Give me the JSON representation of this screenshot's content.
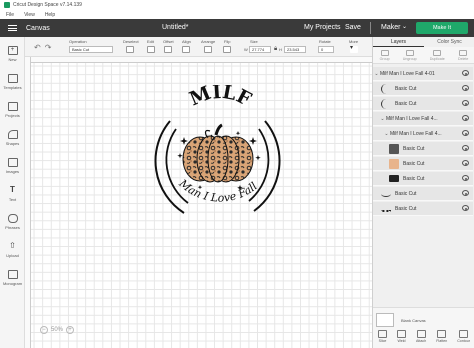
{
  "window": {
    "title": "Cricut Design Space  v7.14.139"
  },
  "menu": [
    "File",
    "View",
    "Help"
  ],
  "header": {
    "canvas_label": "Canvas",
    "doc_title": "Untitled*",
    "my_projects": "My Projects",
    "save": "Save",
    "machine": "Maker",
    "make_it": "Make It"
  },
  "left_tools": [
    "New",
    "Templates",
    "Projects",
    "Shapes",
    "Images",
    "Text",
    "Phrases",
    "Upload",
    "Monogram"
  ],
  "toolbar": {
    "operation_label": "Operation",
    "operation_value": "Basic Cut",
    "deselect": "Deselect",
    "edit": "Edit",
    "offset": "Offset",
    "align": "Align",
    "arrange": "Arrange",
    "flip": "Flip",
    "size": "Size",
    "w_label": "W",
    "w_value": "27.774",
    "h_label": "H",
    "h_value": "23.543",
    "rotate": "Rotate",
    "rotate_value": "0",
    "more": "More"
  },
  "design": {
    "top_text": "MILF",
    "bottom_text": "Man I Love Fall"
  },
  "zoom": {
    "minus": "−",
    "value": "50%",
    "plus": "+"
  },
  "panel": {
    "tabs": [
      "Layers",
      "Color Sync"
    ],
    "actions": [
      "Group",
      "Ungroup",
      "Duplicate",
      "Delete"
    ],
    "layers": [
      {
        "name": "Milf Man I Love Fall 4-01",
        "level": 0,
        "type": "group"
      },
      {
        "name": "Basic Cut",
        "level": 1,
        "type": "layer",
        "thumb": "arc"
      },
      {
        "name": "Basic Cut",
        "level": 1,
        "type": "layer",
        "thumb": "arc"
      },
      {
        "name": "Milf Man I Love Fall 4...",
        "level": 1,
        "type": "group"
      },
      {
        "name": "Milf Man I Love Fall 4...",
        "level": 2,
        "type": "group"
      },
      {
        "name": "Basic Cut",
        "level": 2,
        "type": "layer",
        "thumb": "leopard"
      },
      {
        "name": "Basic Cut",
        "level": 2,
        "type": "layer",
        "thumb": "tan"
      },
      {
        "name": "Basic Cut",
        "level": 2,
        "type": "layer",
        "thumb": "black"
      },
      {
        "name": "Basic Cut",
        "level": 1,
        "type": "layer",
        "thumb": "arc"
      },
      {
        "name": "Basic Cut",
        "level": 1,
        "type": "layer",
        "thumb": "text"
      }
    ],
    "bottom": {
      "blank_canvas": "Blank Canvas",
      "actions": [
        "Slice",
        "Weld",
        "Attach",
        "Flatten",
        "Contour"
      ]
    }
  },
  "colors": {
    "header_bg": "#3a3a3a",
    "make_it_green": "#1fa86a",
    "leopard_tan": "#d9a476",
    "leopard_dark": "#2a2a2a"
  }
}
